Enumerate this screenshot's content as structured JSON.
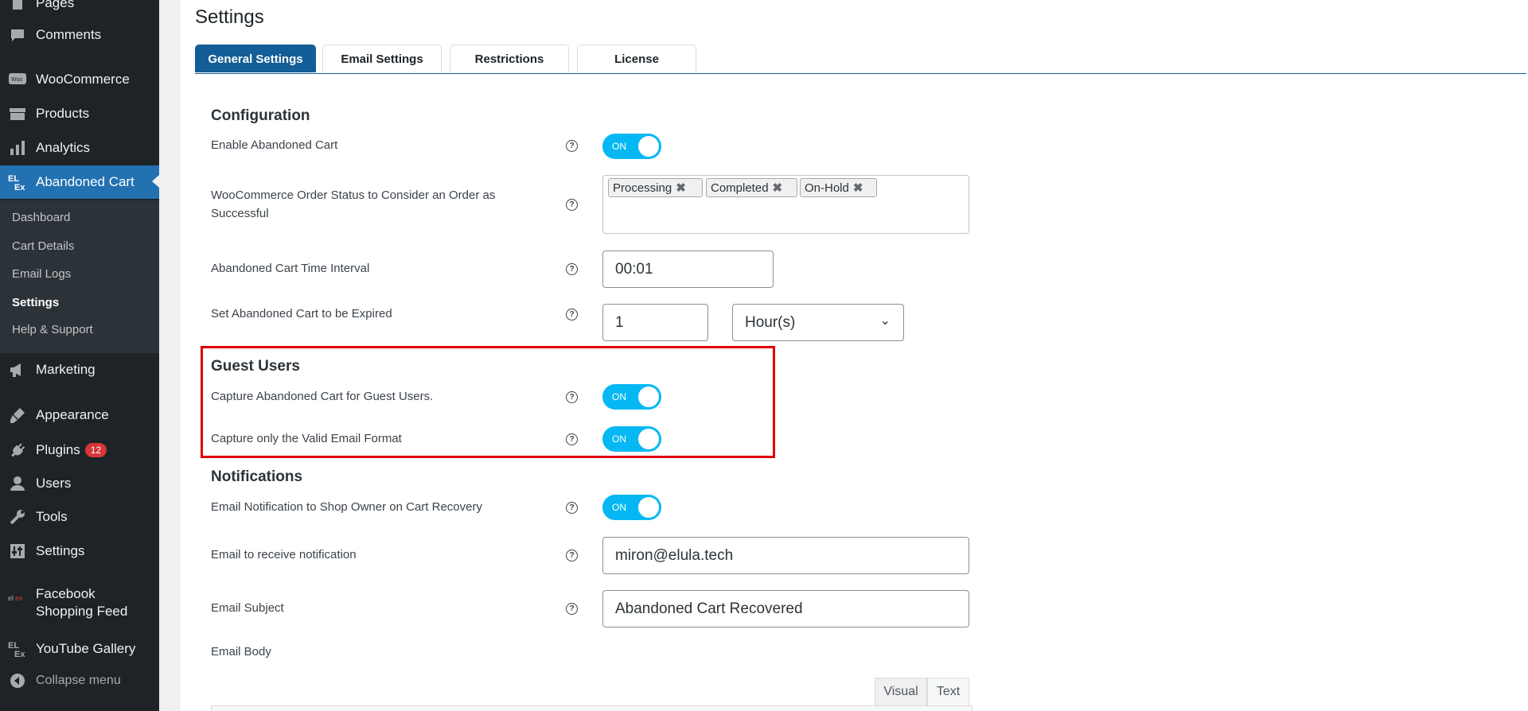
{
  "sidebar": {
    "items": [
      {
        "label": "Pages",
        "icon": "pages-icon",
        "top": 0
      },
      {
        "label": "Comments",
        "icon": "comments-icon",
        "top": 0
      },
      {
        "label": "WooCommerce",
        "icon": "woocommerce-icon",
        "top": 0
      },
      {
        "label": "Products",
        "icon": "products-icon",
        "top": 0
      },
      {
        "label": "Analytics",
        "icon": "analytics-icon",
        "top": 0
      },
      {
        "label": "Abandoned Cart",
        "icon": "elex-icon",
        "top": 0
      },
      {
        "label": "Marketing",
        "icon": "marketing-icon",
        "top": 0
      },
      {
        "label": "Appearance",
        "icon": "appearance-icon",
        "top": 0
      },
      {
        "label": "Plugins",
        "icon": "plugins-icon",
        "top": 0,
        "badge": "12"
      },
      {
        "label": "Users",
        "icon": "users-icon",
        "top": 0
      },
      {
        "label": "Tools",
        "icon": "tools-icon",
        "top": 0
      },
      {
        "label": "Settings",
        "icon": "settings-icon",
        "top": 0
      },
      {
        "label": "Facebook Shopping Feed",
        "icon": "facebook-feed-icon",
        "top": 0
      },
      {
        "label": "YouTube Gallery",
        "icon": "elex-icon",
        "top": 0
      },
      {
        "label": "Collapse menu",
        "icon": "collapse-icon",
        "top": 0
      }
    ],
    "submenu": [
      "Dashboard",
      "Cart Details",
      "Email Logs",
      "Settings",
      "Help & Support"
    ]
  },
  "page": {
    "title": "Settings",
    "tabs": [
      "General Settings",
      "Email Settings",
      "Restrictions",
      "License"
    ]
  },
  "configuration": {
    "heading": "Configuration",
    "enable_label": "Enable Abandoned Cart",
    "toggle_on": "ON",
    "order_status_label": "WooCommerce Order Status to Consider an Order as Successful",
    "order_statuses": [
      "Processing",
      "Completed",
      "On-Hold"
    ],
    "interval_label": "Abandoned Cart Time Interval",
    "interval_value": "00:01",
    "expire_label": "Set Abandoned Cart to be Expired",
    "expire_value": "1",
    "expire_unit": "Hour(s)"
  },
  "guest_users": {
    "heading": "Guest Users",
    "capture_label": "Capture Abandoned Cart for Guest Users.",
    "valid_email_label": "Capture only the Valid Email Format"
  },
  "notifications": {
    "heading": "Notifications",
    "shop_owner_label": "Email Notification to Shop Owner on Cart Recovery",
    "email_label": "Email to receive notification",
    "email_value": "miron@elula.tech",
    "subject_label": "Email Subject",
    "subject_value": "Abandoned Cart Recovered",
    "body_label": "Email Body",
    "editor_tabs": [
      "Visual",
      "Text"
    ]
  },
  "colors": {
    "accent": "#2271b1",
    "toggle": "#05b8f3",
    "highlight": "#e00000",
    "sidebar": "#1d2327"
  }
}
